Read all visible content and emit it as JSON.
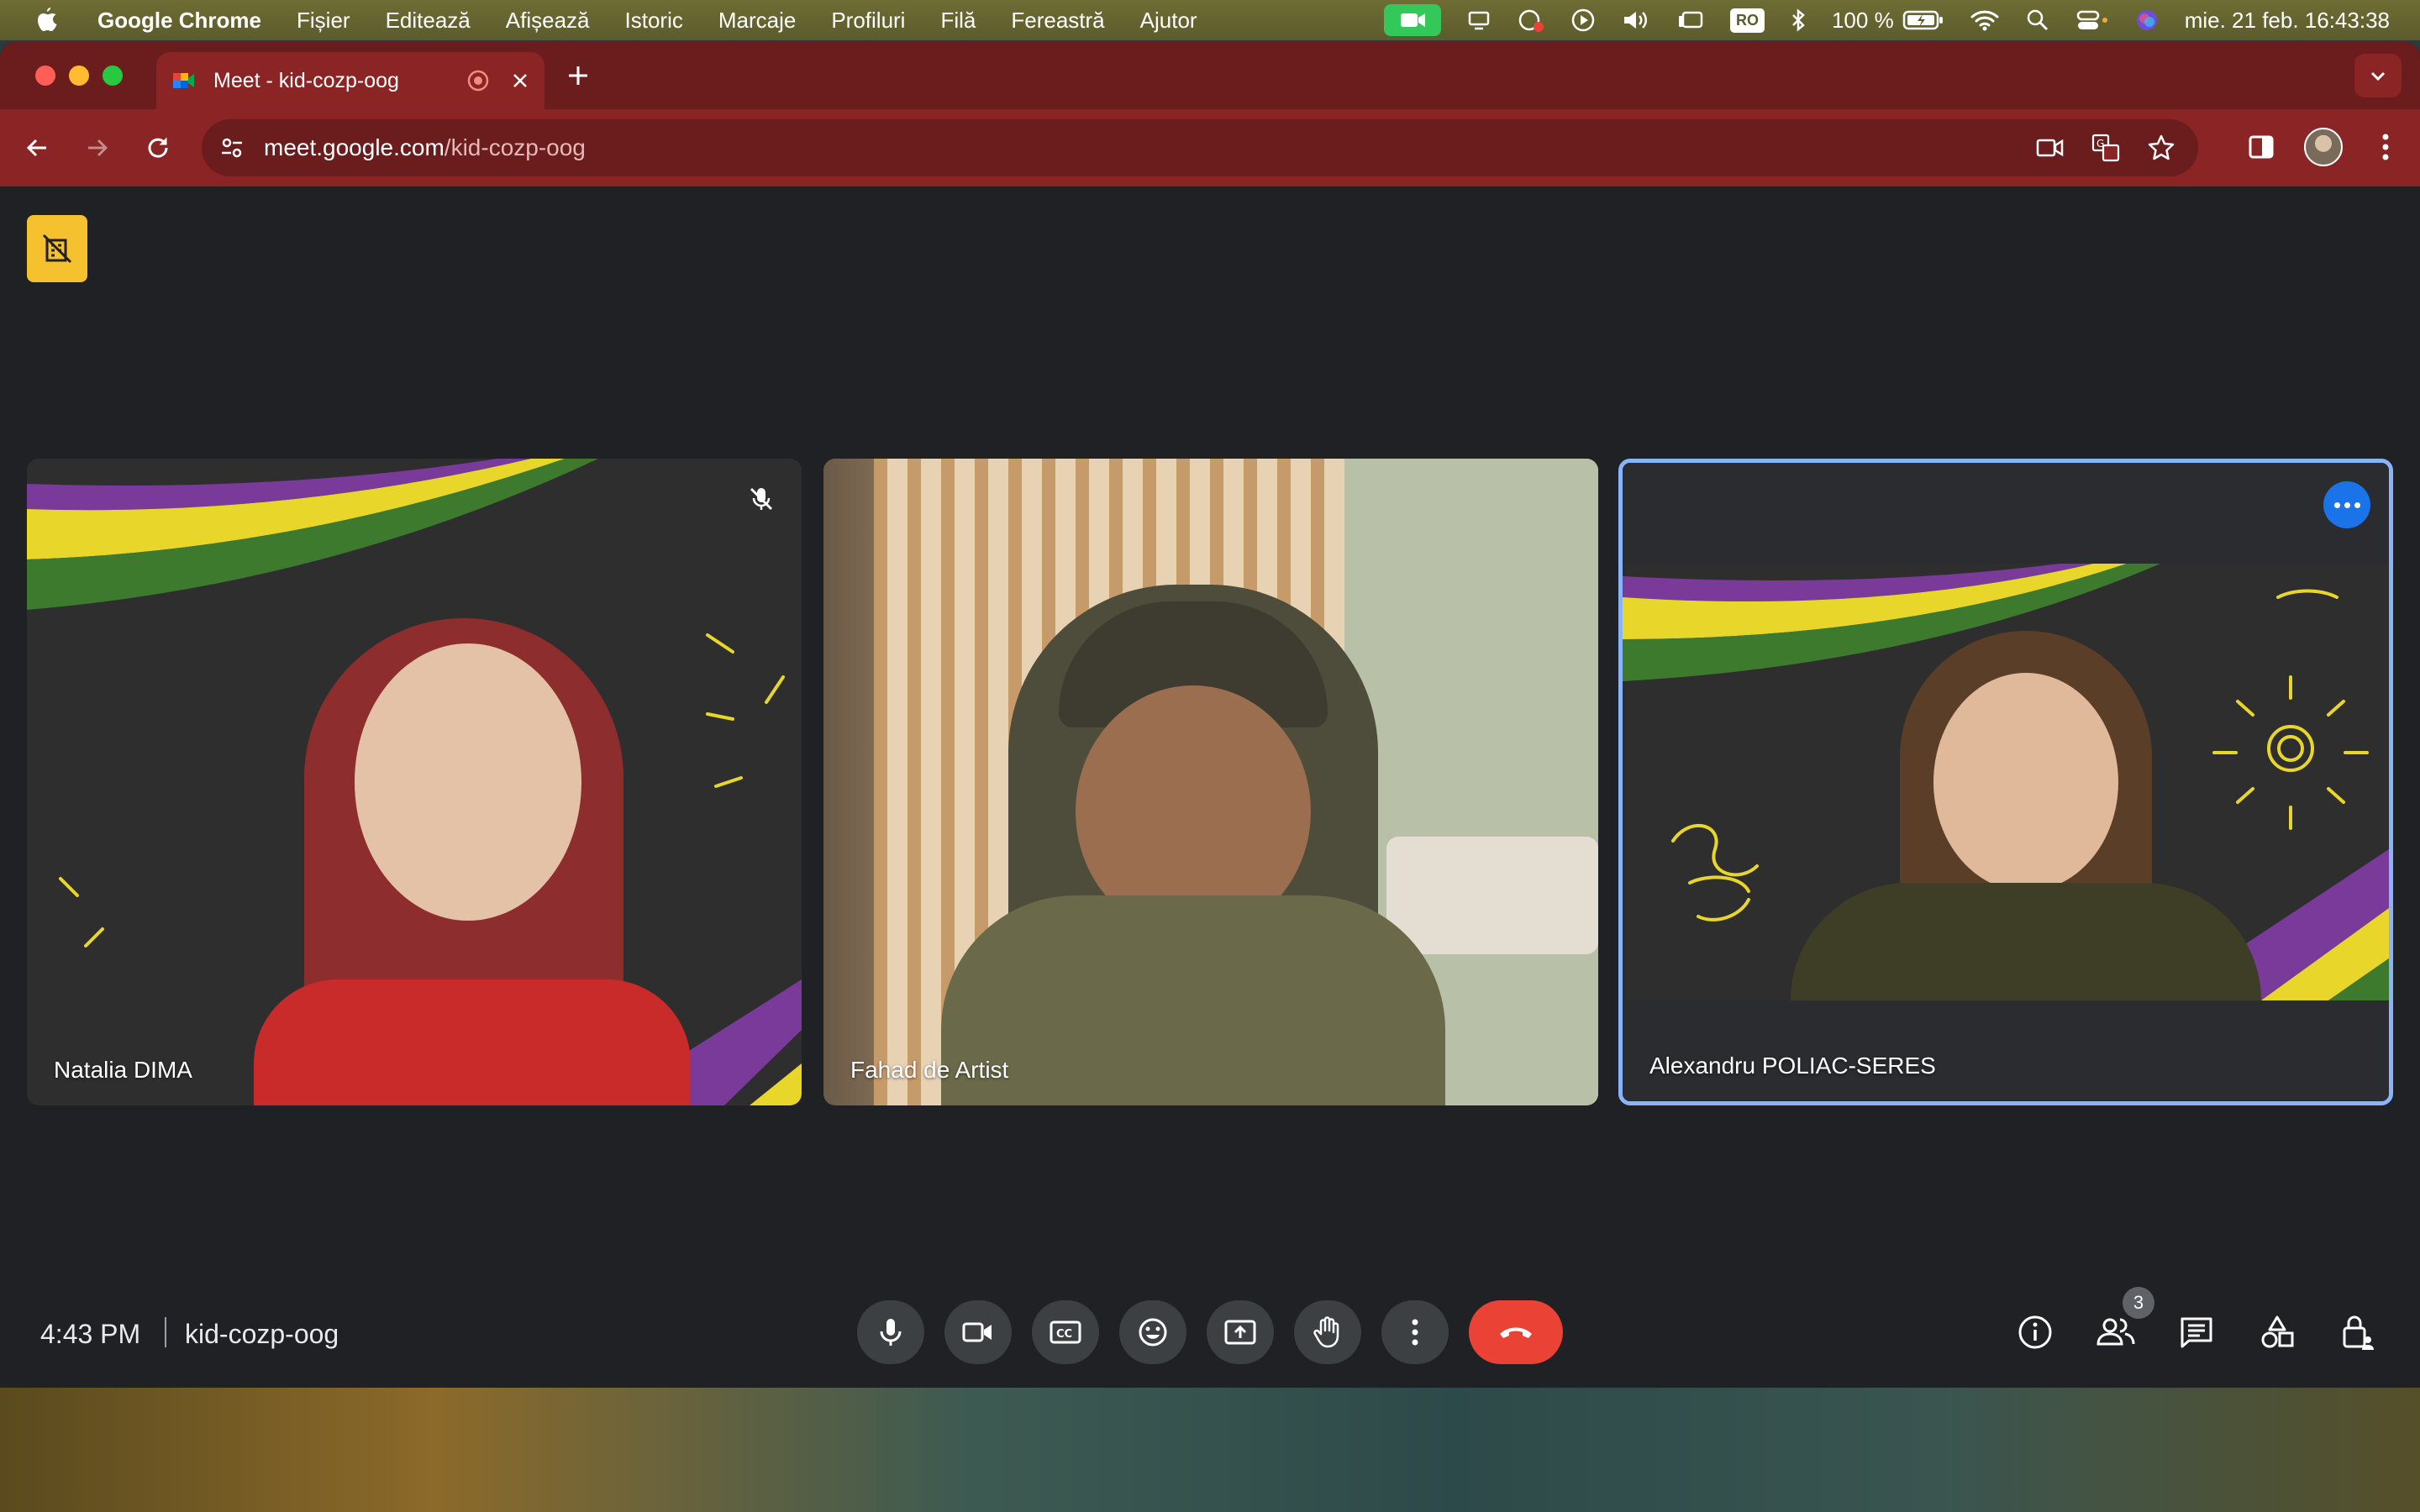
{
  "menubar": {
    "app_name": "Google Chrome",
    "items": [
      "Fișier",
      "Editează",
      "Afișează",
      "Istoric",
      "Marcaje",
      "Profiluri",
      "Filă",
      "Fereastră",
      "Ajutor"
    ],
    "battery": "100 %",
    "input_source": "RO",
    "clock": "mie. 21 feb.  16:43:38"
  },
  "browser": {
    "tab_title": "Meet - kid-cozp-oog",
    "url_host": "meet.google.com",
    "url_path": "/kid-cozp-oog"
  },
  "meet": {
    "participants": [
      {
        "name": "Natalia DIMA",
        "muted": true
      },
      {
        "name": "Fahad de Artist",
        "muted": false
      },
      {
        "name": "Alexandru POLIAC-SERES",
        "muted": false,
        "active": true
      }
    ],
    "time": "4:43 PM",
    "meeting_code": "kid-cozp-oog",
    "people_count": "3"
  },
  "colors": {
    "tab_bar": "#6b1c1c",
    "toolbar": "#8b2424",
    "meet_bg": "#202124",
    "hangup": "#ea4335",
    "active_border": "#8ab4f8",
    "more_button": "#1a73e8",
    "noreplace": "#f6c12f"
  }
}
